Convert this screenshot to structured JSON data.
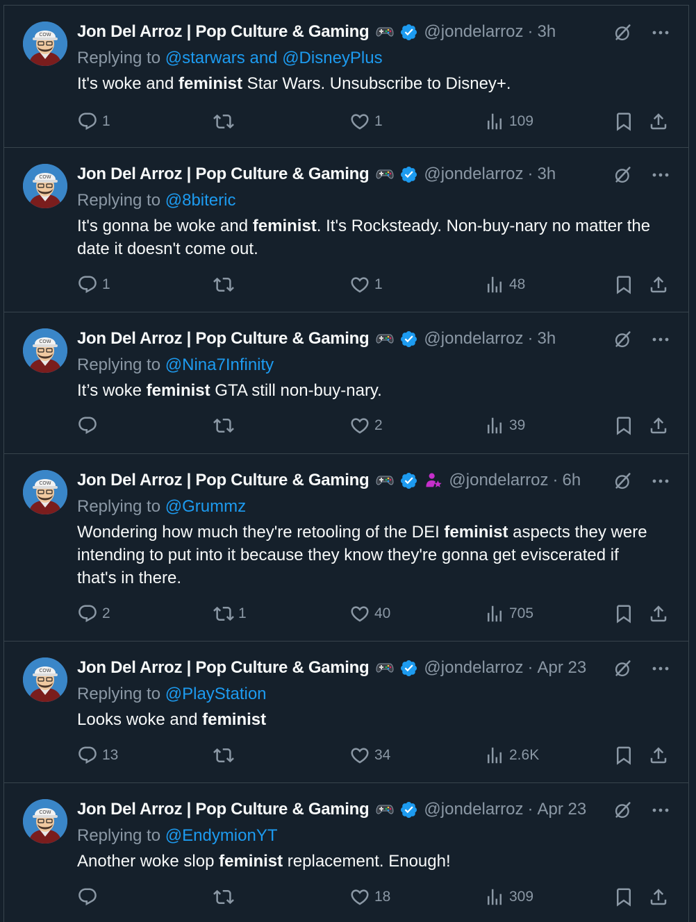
{
  "author": {
    "name": "Jon Del Arroz | Pop Culture & Gaming",
    "handle": "@jondelarroz"
  },
  "labels": {
    "replying_to": "Replying to",
    "and": "and"
  },
  "colors": {
    "background": "#15202b",
    "border": "#38444d",
    "text": "#f7f9f9",
    "secondary": "#8b98a5",
    "accent": "#1d9bf0",
    "affiliate_badge": "#c52fcb"
  },
  "icons": [
    "gamepad-icon",
    "verified-badge-icon",
    "affiliate-badge-icon",
    "grok-icon",
    "more-icon",
    "reply-icon",
    "retweet-icon",
    "like-icon",
    "views-icon",
    "bookmark-icon",
    "share-icon"
  ],
  "tweets": [
    {
      "time": "3h",
      "mentions": [
        "@starwars",
        "@DisneyPlus"
      ],
      "text_before": "It's woke and ",
      "text_bold": "feminist",
      "text_after": " Star Wars. Unsubscribe to Disney+.",
      "replies": "1",
      "retweets": "",
      "likes": "1",
      "views": "109",
      "affiliate": false
    },
    {
      "time": "3h",
      "mentions": [
        "@8biteric"
      ],
      "text_before": "It's gonna be woke and ",
      "text_bold": "feminist",
      "text_after": ". It's Rocksteady. Non-buy-nary no matter the date it doesn't come out.",
      "replies": "1",
      "retweets": "",
      "likes": "1",
      "views": "48",
      "affiliate": false
    },
    {
      "time": "3h",
      "mentions": [
        "@Nina7Infinity"
      ],
      "text_before": "It’s woke ",
      "text_bold": "feminist",
      "text_after": " GTA still non-buy-nary.",
      "replies": "",
      "retweets": "",
      "likes": "2",
      "views": "39",
      "affiliate": false
    },
    {
      "time": "6h",
      "mentions": [
        "@Grummz"
      ],
      "text_before": "Wondering how much they're retooling of the DEI ",
      "text_bold": "feminist",
      "text_after": " aspects they were intending to put into it because they know they're gonna get eviscerated if that's in there.",
      "replies": "2",
      "retweets": "1",
      "likes": "40",
      "views": "705",
      "affiliate": true
    },
    {
      "time": "Apr 23",
      "mentions": [
        "@PlayStation"
      ],
      "text_before": "Looks woke and ",
      "text_bold": "feminist",
      "text_after": "",
      "replies": "13",
      "retweets": "",
      "likes": "34",
      "views": "2.6K",
      "affiliate": false
    },
    {
      "time": "Apr 23",
      "mentions": [
        "@EndymionYT"
      ],
      "text_before": "Another woke slop ",
      "text_bold": "feminist",
      "text_after": " replacement. Enough!",
      "replies": "",
      "retweets": "",
      "likes": "18",
      "views": "309",
      "affiliate": false
    }
  ]
}
